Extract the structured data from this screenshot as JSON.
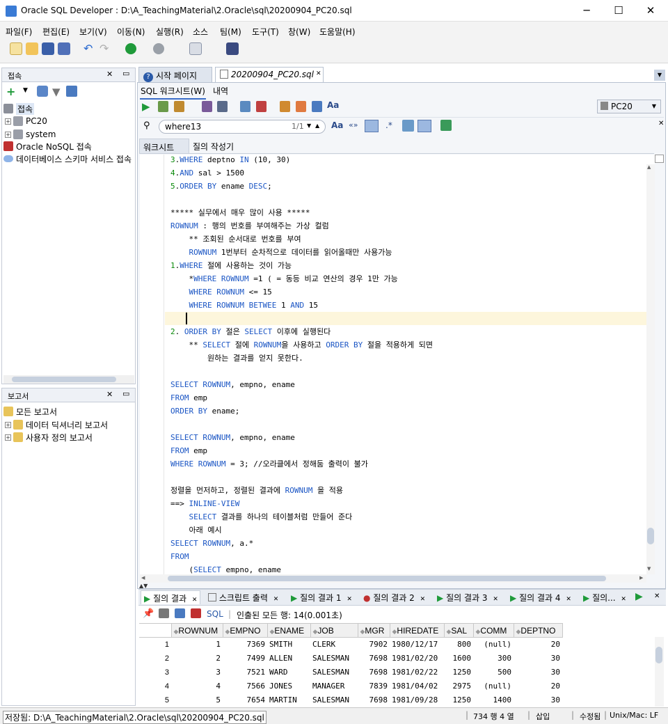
{
  "window": {
    "title": "Oracle SQL Developer : D:\\A_TeachingMaterial\\2.Oracle\\sql\\20200904_PC20.sql",
    "minimize": "─",
    "maximize": "☐",
    "close": "✕"
  },
  "menu": [
    "파일(F)",
    "편집(E)",
    "보기(V)",
    "이동(N)",
    "실행(R)",
    "소스",
    "팀(M)",
    "도구(T)",
    "창(W)",
    "도움말(H)"
  ],
  "connections_panel": {
    "title": "접속",
    "root": "접속",
    "items": [
      "PC20",
      "system",
      "Oracle NoSQL 접속",
      "데이터베이스 스키마 서비스 접속"
    ]
  },
  "reports_panel": {
    "title": "보고서",
    "items": [
      "모든 보고서",
      "데이터 딕셔너리 보고서",
      "사용자 정의 보고서"
    ]
  },
  "editor_tabs": [
    "시작 페이지",
    "20200904_PC20.sql"
  ],
  "subtabs": [
    "SQL 워크시트(W)",
    "내역"
  ],
  "connection_select": "PC20",
  "search": {
    "value": "where13",
    "count": "1/1"
  },
  "worksheet_tabs": [
    "워크시트",
    "질의 작성기"
  ],
  "code_lines": [
    "3.WHERE deptno IN (10, 30)",
    "4.AND sal > 1500",
    "5.ORDER BY ename DESC;",
    "",
    "***** 실무에서 매우 많이 사용 *****",
    "ROWNUM : 행의 번호를 부여해주는 가상 컬럼",
    "    ** 조회된 순서대로 번호를 부여",
    "    ROWNUM 1번부터 순차적으로 데이터를 읽어올때만 사용가능",
    "1.WHERE 절에 사용하는 것이 가능",
    "    *WHERE ROWNUM =1 ( = 동등 비교 연산의 경우 1만 가능",
    "    WHERE ROWNUM <= 15",
    "    WHERE ROWNUM BETWEE 1 AND 15",
    "",
    "2. ORDER BY 절은 SELECT 이후에 실행된다",
    "    ** SELECT 절에 ROWNUM을 사용하고 ORDER BY 절을 적용하게 되면",
    "        원하는 결과를 얻지 못한다.",
    "",
    "SELECT ROWNUM, empno, ename",
    "FROM emp",
    "ORDER BY ename;",
    "",
    "SELECT ROWNUM, empno, ename",
    "FROM emp",
    "WHERE ROWNUM = 3; //오라클에서 정해둠 출력이 불가",
    "",
    "정렬을 먼저하고, 정렬된 결과에 ROWNUM 을 적용",
    "==> INLINE-VIEW",
    "    SELECT 결과를 하나의 테이블처럼 만들어 준다",
    "    아래 예시",
    "SELECT ROWNUM, a.*",
    "FROM",
    "    (SELECT empno, ename"
  ],
  "result_tabs": [
    "질의 결과",
    "스크립트 출력",
    "질의 결과 1",
    "질의 결과 2",
    "질의 결과 3",
    "질의 결과 4",
    "질의..."
  ],
  "result_toolbar": {
    "sql_label": "SQL",
    "fetched": "인출된 모든 행: 14(0.001초)"
  },
  "table": {
    "columns": [
      "ROWNUM",
      "EMPNO",
      "ENAME",
      "JOB",
      "MGR",
      "HIREDATE",
      "SAL",
      "COMM",
      "DEPTNO"
    ],
    "rows": [
      [
        "1",
        "1",
        "7369",
        "SMITH",
        "CLERK",
        "7902",
        "1980/12/17",
        "800",
        "(null)",
        "20"
      ],
      [
        "2",
        "2",
        "7499",
        "ALLEN",
        "SALESMAN",
        "7698",
        "1981/02/20",
        "1600",
        "300",
        "30"
      ],
      [
        "3",
        "3",
        "7521",
        "WARD",
        "SALESMAN",
        "7698",
        "1981/02/22",
        "1250",
        "500",
        "30"
      ],
      [
        "4",
        "4",
        "7566",
        "JONES",
        "MANAGER",
        "7839",
        "1981/04/02",
        "2975",
        "(null)",
        "20"
      ],
      [
        "5",
        "5",
        "7654",
        "MARTIN",
        "SALESMAN",
        "7698",
        "1981/09/28",
        "1250",
        "1400",
        "30"
      ]
    ]
  },
  "status": {
    "saved": "저장됨: D:\\A_TeachingMaterial\\2.Oracle\\sql\\20200904_PC20.sql",
    "position": "734 행 4 열",
    "mode": "삽입",
    "modified": "수정됨",
    "eol": "Unix/Mac: LF"
  }
}
